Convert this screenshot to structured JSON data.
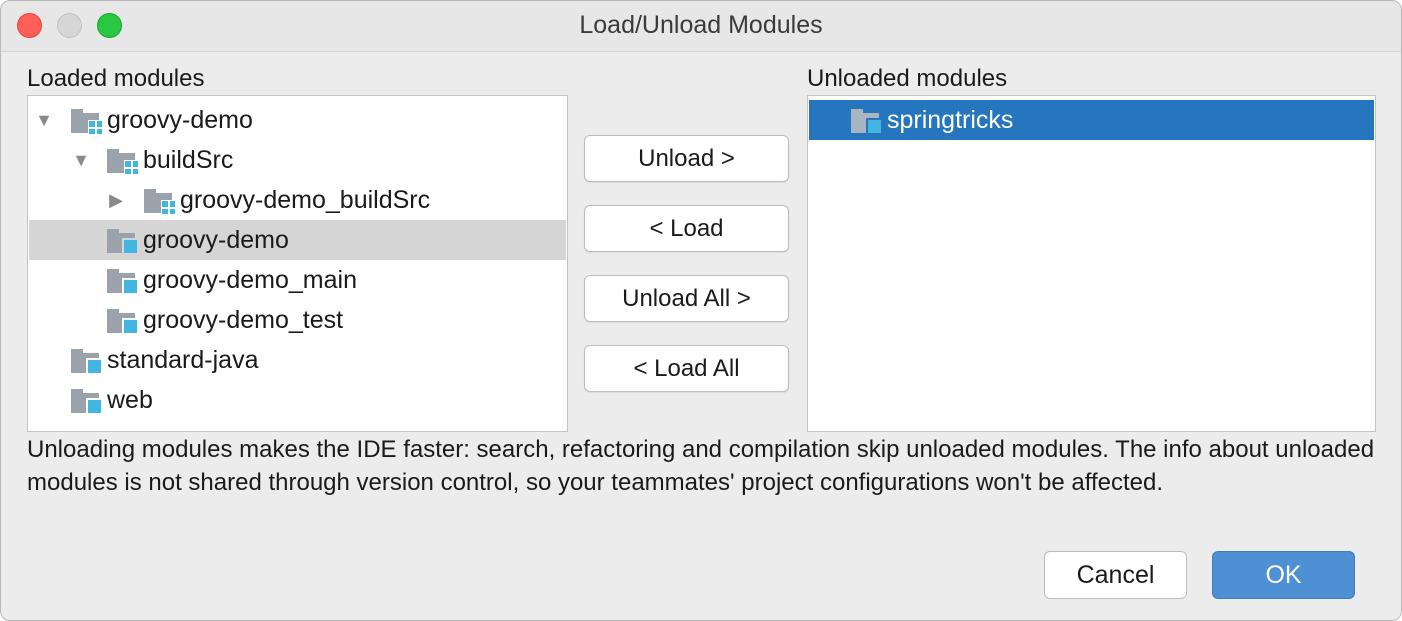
{
  "window": {
    "title": "Load/Unload Modules"
  },
  "loaded": {
    "label": "Loaded modules",
    "items": [
      {
        "label": "groovy-demo",
        "expander": "expanded",
        "icon": "module-group-icon"
      },
      {
        "label": "buildSrc",
        "expander": "expanded",
        "icon": "module-group-icon"
      },
      {
        "label": "groovy-demo_buildSrc",
        "expander": "collapsed",
        "icon": "module-group-icon"
      },
      {
        "label": "groovy-demo",
        "expander": "none",
        "icon": "module-icon",
        "selected": true
      },
      {
        "label": "groovy-demo_main",
        "expander": "none",
        "icon": "module-icon"
      },
      {
        "label": "groovy-demo_test",
        "expander": "none",
        "icon": "module-icon"
      },
      {
        "label": "standard-java",
        "expander": "none",
        "icon": "module-icon"
      },
      {
        "label": "web",
        "expander": "none",
        "icon": "module-icon"
      }
    ]
  },
  "unloaded": {
    "label": "Unloaded modules",
    "items": [
      {
        "label": "springtricks",
        "icon": "module-icon",
        "selected": true
      }
    ]
  },
  "actions": {
    "unload": "Unload >",
    "load": "< Load",
    "unload_all": "Unload All >",
    "load_all": "< Load All"
  },
  "description": "Unloading modules makes the IDE faster: search, refactoring and compilation skip unloaded modules. The info about unloaded modules is not shared through version control, so your teammates' project configurations won't be affected.",
  "footer": {
    "cancel": "Cancel",
    "ok": "OK"
  },
  "icons": {
    "expanded": "▼",
    "collapsed": "▶"
  },
  "colors": {
    "selection": "#2675bf",
    "inactive_selection": "#d5d5d5",
    "module_accent": "#40b6e0",
    "ok_button": "#4f8fd3",
    "close": "#fe5f57",
    "zoom": "#29c840"
  }
}
